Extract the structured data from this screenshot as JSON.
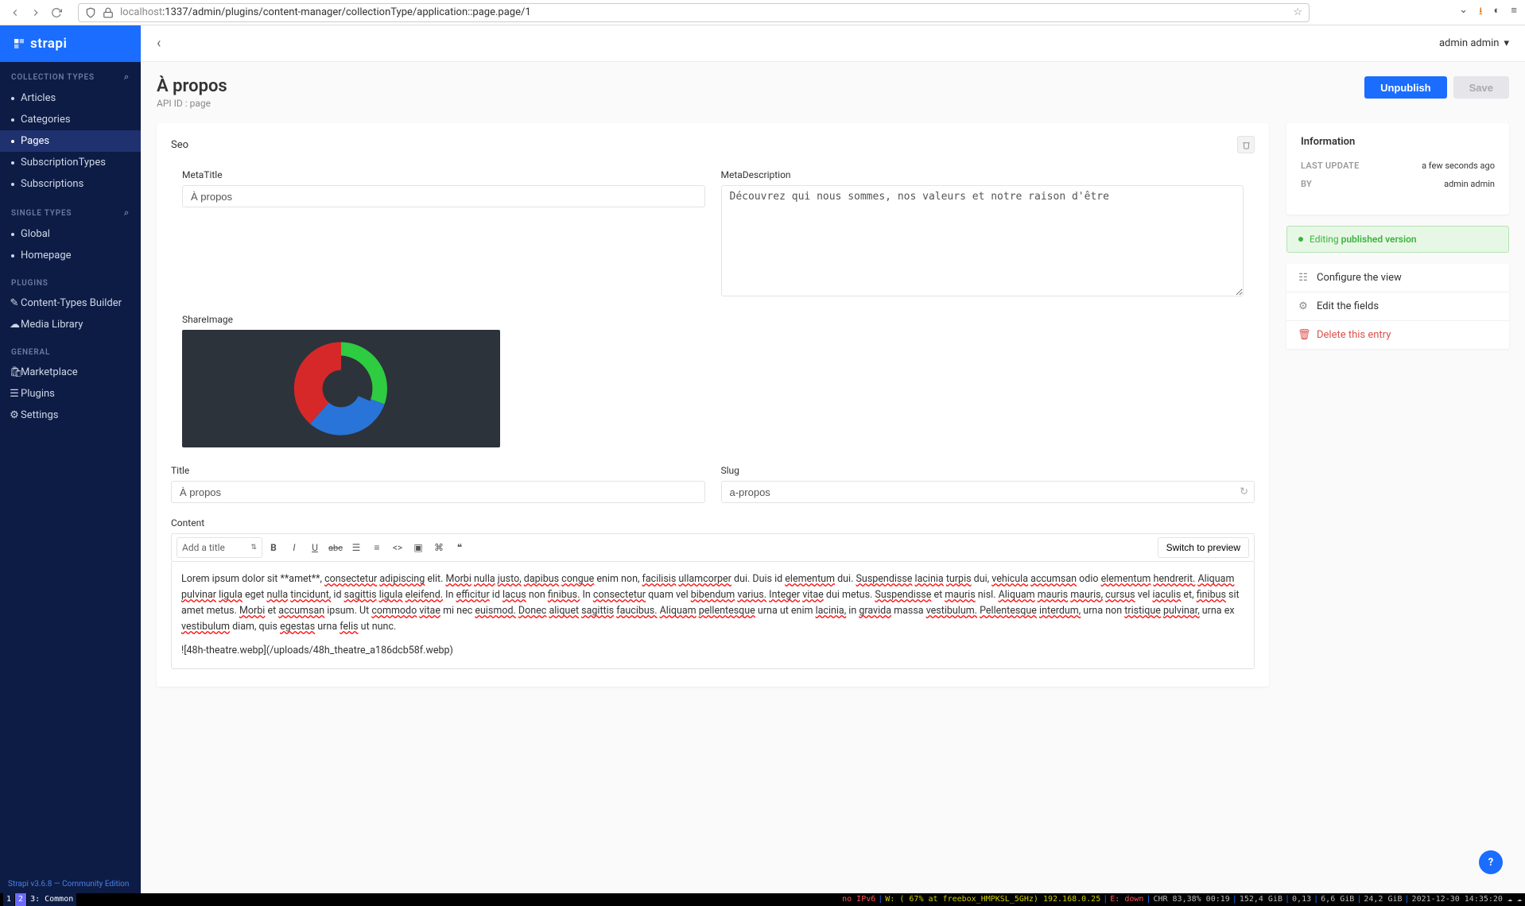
{
  "browser": {
    "url_host": "localhost",
    "url_path": ":1337/admin/plugins/content-manager/collectionType/application::page.page/1"
  },
  "logo": "strapi",
  "user_name": "admin admin",
  "sidebar": {
    "collection_label": "COLLECTION TYPES",
    "collection_items": [
      "Articles",
      "Categories",
      "Pages",
      "SubscriptionTypes",
      "Subscriptions"
    ],
    "collection_active_index": 2,
    "single_label": "SINGLE TYPES",
    "single_items": [
      "Global",
      "Homepage"
    ],
    "plugins_label": "PLUGINS",
    "plugins_items": [
      {
        "icon": "✎",
        "label": "Content-Types Builder"
      },
      {
        "icon": "☁",
        "label": "Media Library"
      }
    ],
    "general_label": "GENERAL",
    "general_items": [
      {
        "icon": "🛍",
        "label": "Marketplace"
      },
      {
        "icon": "☰",
        "label": "Plugins"
      },
      {
        "icon": "⚙",
        "label": "Settings"
      }
    ],
    "footer": "Strapi v3.6.8 — Community Edition"
  },
  "page": {
    "title": "À propos",
    "api_id_label": "API ID : page",
    "unpublish_label": "Unpublish",
    "save_label": "Save"
  },
  "seo": {
    "heading": "Seo",
    "meta_title_label": "MetaTitle",
    "meta_title_value": "À propos",
    "meta_desc_label": "MetaDescription",
    "meta_desc_value": "Découvrez qui nous sommes, nos valeurs et notre raison d'être",
    "share_image_label": "ShareImage"
  },
  "fields": {
    "title_label": "Title",
    "title_value": "À propos",
    "slug_label": "Slug",
    "slug_value": "a-propos",
    "content_label": "Content"
  },
  "editor": {
    "heading_select": "Add a title",
    "switch_label": "Switch to preview",
    "body": "Lorem ipsum dolor sit **amet**, consectetur adipiscing elit. Morbi nulla justo, dapibus congue enim non, facilisis ullamcorper dui. Duis id elementum dui. Suspendisse lacinia turpis dui, vehicula accumsan odio elementum hendrerit. Aliquam pulvinar ligula eget nulla tincidunt, id sagittis ligula eleifend. In efficitur id lacus non finibus. In consectetur quam vel bibendum varius. Integer vitae dui metus. Suspendisse et mauris nisl. Aliquam mauris mauris, cursus vel iaculis et, finibus sit amet metus. Morbi et accumsan ipsum. Ut commodo vitae mi nec euismod. Donec aliquet sagittis faucibus. Aliquam pellentesque urna ut enim lacinia, in gravida massa vestibulum. Pellentesque interdum, urna non tristique pulvinar, urna ex vestibulum diam, quis egestas urna felis ut nunc.",
    "body_line2": "![48h-theatre.webp](/uploads/48h_theatre_a186dcb58f.webp)"
  },
  "info": {
    "title": "Information",
    "last_update_label": "LAST UPDATE",
    "last_update_value": "a few seconds ago",
    "by_label": "BY",
    "by_value": "admin admin"
  },
  "status": {
    "prefix": "Editing",
    "rest": "published version"
  },
  "actions": {
    "configure": "Configure the view",
    "edit_fields": "Edit the fields",
    "delete": "Delete this entry"
  },
  "osbar": {
    "t1": "1",
    "t2": "2",
    "t3": "3: Common",
    "no_ipv6": "no IPv6",
    "wifi": "W: ( 67% at freebox_HMPKSL_5GHz) 192.168.0.25",
    "eth": "E: down",
    "stats": "CHR 83,38% 00:19",
    "mem1": "152,4 GiB",
    "mem2": "0,13",
    "mem3": "6,6 GiB",
    "mem4": "24,2 GiB",
    "dt": "2021-12-30 14:35:20"
  }
}
